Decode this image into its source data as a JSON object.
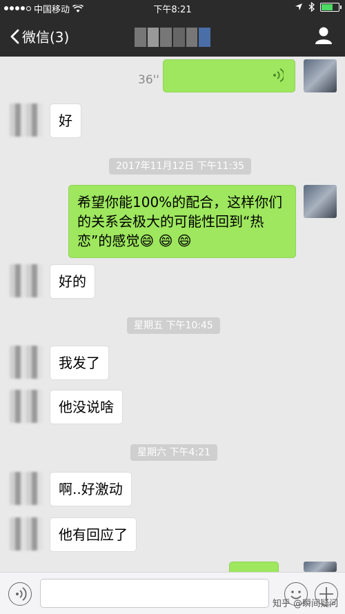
{
  "status_bar": {
    "carrier": "中国移动",
    "time": "下午8:21",
    "icons": [
      "signal-dots-icon",
      "wifi-icon",
      "location-arrow-icon",
      "bluetooth-icon",
      "battery-icon"
    ]
  },
  "nav": {
    "back_label": "微信(3)",
    "contact_icon": "person-icon"
  },
  "messages": {
    "voice_duration": "36''",
    "m1": "好",
    "ts1": "2017年11月12日 下午11:35",
    "m2": "希望你能100%的配合，这样你们的关系会极大的可能性回到“热恋”的感觉😄 😄 😄",
    "m3": "好的",
    "ts2": "星期五 下午10:45",
    "m4": "我发了",
    "m5": "他没说啥",
    "ts3": "星期六 下午4:21",
    "m6": "啊..好激动",
    "m7": "他有回应了"
  },
  "input_bar": {
    "watermark": "知乎 @瞬间疑问"
  },
  "colors": {
    "header_bg": "#2b2b2b",
    "chat_bg": "#e9e9e9",
    "outgoing_bubble": "#9ee75e",
    "incoming_bubble": "#ffffff"
  }
}
